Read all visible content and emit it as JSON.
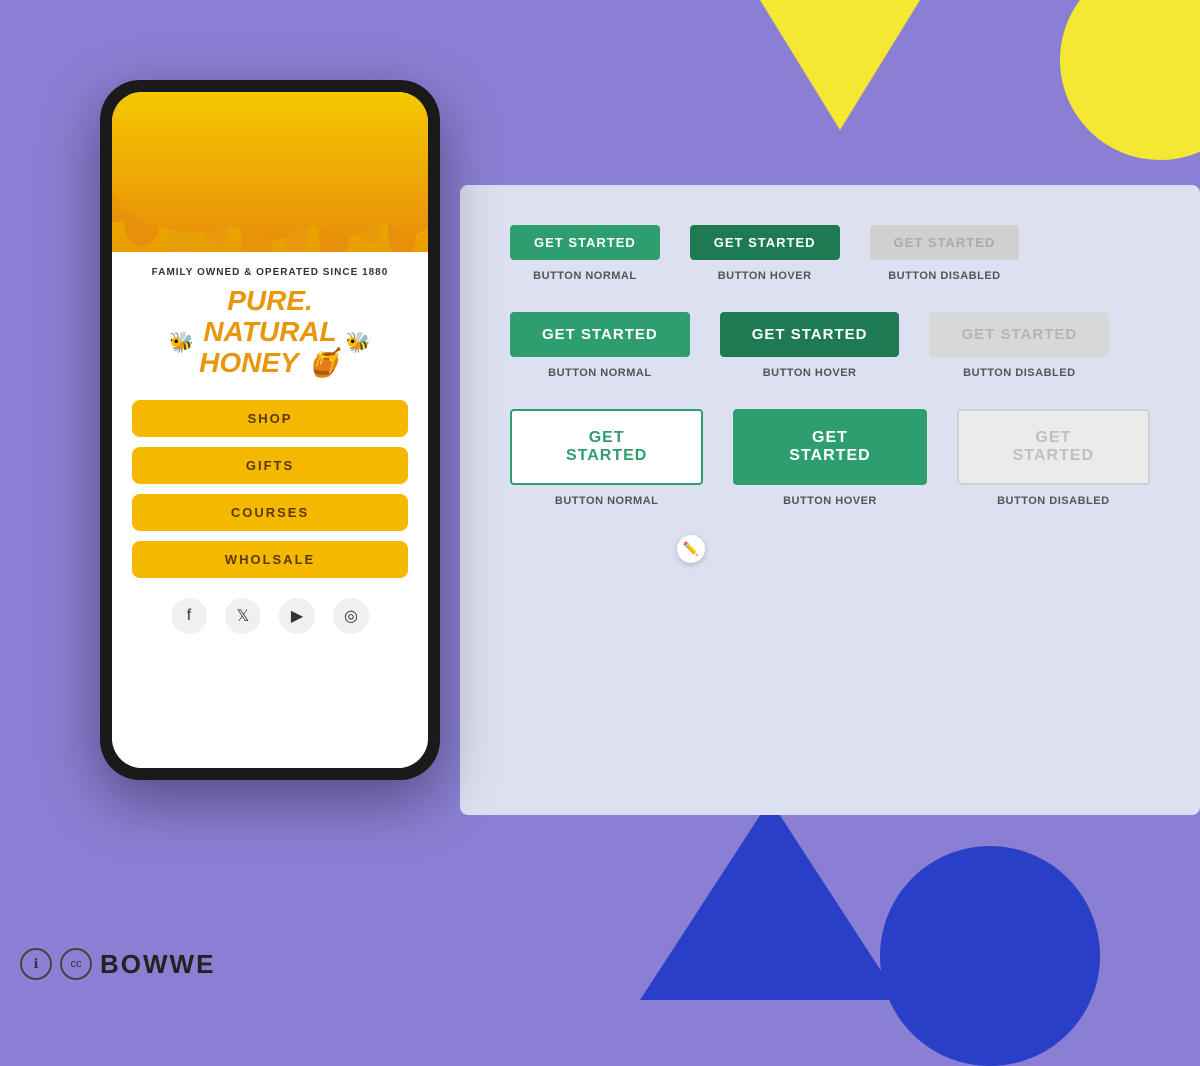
{
  "background": {
    "color": "#8b7fd4"
  },
  "phone": {
    "tagline": "FAMILY OWNED & OPERATED SINCE 1880",
    "title_line1": "PURE.",
    "title_line2": "NATURAL",
    "title_line3": "HONEY",
    "nav_buttons": [
      "SHOP",
      "GIFTS",
      "COURSES",
      "WHOLSALE"
    ],
    "social_icons": [
      "f",
      "𝕏",
      "▶",
      "📷"
    ]
  },
  "button_rows": [
    {
      "size": "small",
      "buttons": [
        {
          "label": "GET STARTED",
          "state": "normal",
          "desc": "BUTTON NORMAL"
        },
        {
          "label": "GET STARTED",
          "state": "hover",
          "desc": "BUTTON HOVER"
        },
        {
          "label": "GET STARTED",
          "state": "disabled",
          "desc": "BUTTON DISABLED"
        }
      ]
    },
    {
      "size": "medium",
      "buttons": [
        {
          "label": "GET STARTED",
          "state": "normal",
          "desc": "BUTTON NORMAL"
        },
        {
          "label": "GET STARTED",
          "state": "hover",
          "desc": "BUTTON HOVER"
        },
        {
          "label": "GET STARTED",
          "state": "disabled",
          "desc": "BUTTON DISABLED"
        }
      ]
    },
    {
      "size": "large",
      "buttons": [
        {
          "label": "GET STARTED",
          "state": "normal",
          "desc": "BUTTON NORMAL"
        },
        {
          "label": "GET STARTED",
          "state": "hover",
          "desc": "BUTTON HOVER"
        },
        {
          "label": "GET STARTED",
          "state": "disabled",
          "desc": "BUTTON DISABLED"
        }
      ]
    }
  ],
  "footer": {
    "info_icon": "ℹ",
    "cc_icon": "©",
    "logo": "BOWWE"
  }
}
